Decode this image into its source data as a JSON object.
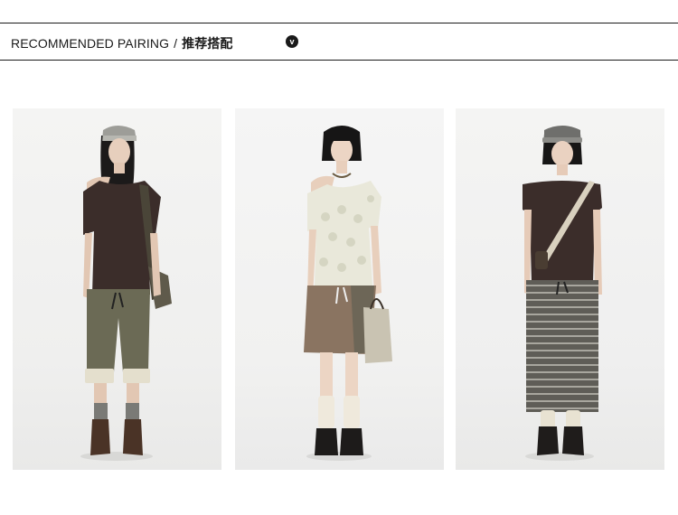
{
  "header": {
    "title_en": "RECOMMENDED PAIRING",
    "separator": "/",
    "title_cn": "推荐搭配",
    "badge_icon": "chevron-down-icon",
    "badge_glyph": "v"
  },
  "photos": [
    {
      "name": "outfit-photo-1",
      "subject": "brown off-shoulder top, cuffed olive shorts, plaid hat, grey socks, brown boots"
    },
    {
      "name": "outfit-photo-2",
      "subject": "cream dotted off-shoulder blouse, brown wrap skirt, white slouch socks, black loafers, handbag"
    },
    {
      "name": "outfit-photo-3",
      "subject": "brown boat-neck top, grey striped maxi skirt, grey cap, crossbody strap, black loafers"
    }
  ],
  "colors": {
    "line": "#1a1a1a",
    "text": "#1a1a1a",
    "background": "#ffffff"
  }
}
